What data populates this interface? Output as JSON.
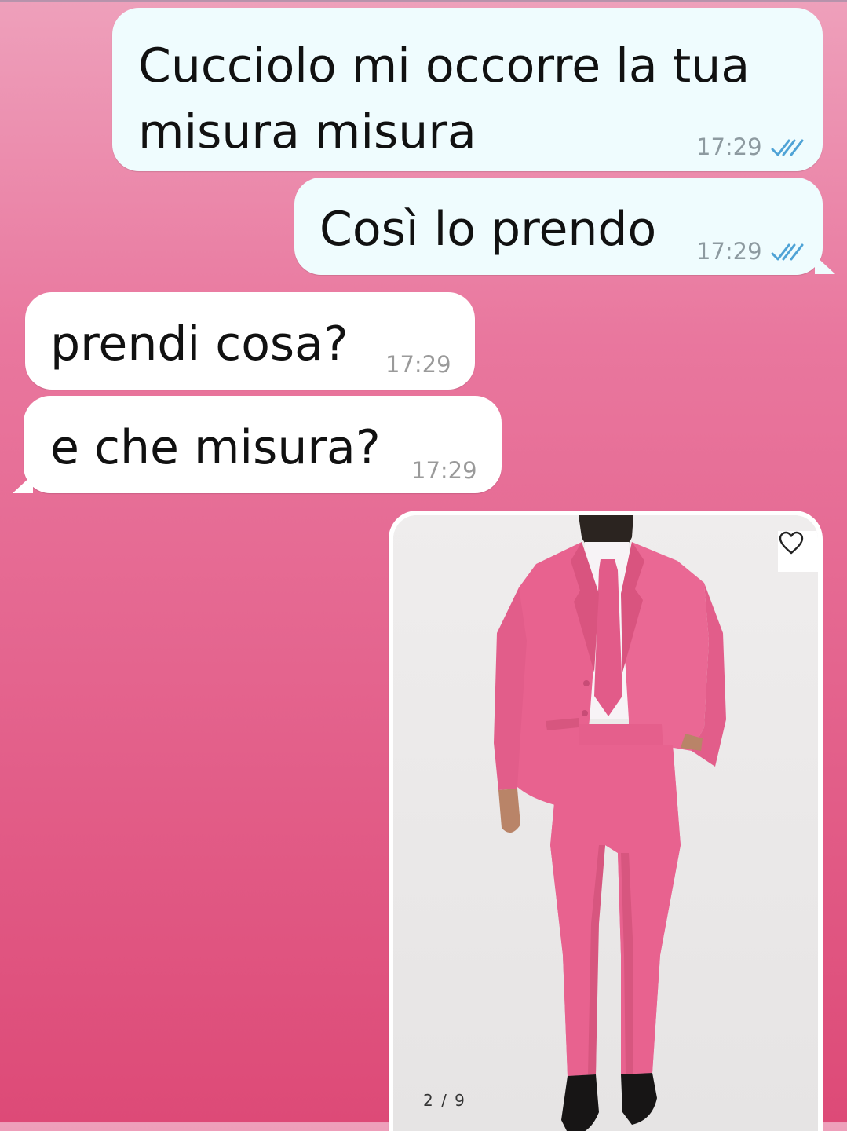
{
  "chat": {
    "messages": [
      {
        "direction": "out",
        "text": "Cucciolo mi occorre la tua\nmisura misura",
        "time": "17:29",
        "status": "read"
      },
      {
        "direction": "out",
        "text": "Così lo prendo",
        "time": "17:29",
        "status": "read"
      },
      {
        "direction": "in",
        "text": "prendi cosa?",
        "time": "17:29"
      },
      {
        "direction": "in",
        "text": "e che misura?",
        "time": "17:29"
      }
    ],
    "image_message": {
      "direction": "out",
      "content": "pink-suit-product-photo",
      "counter": "2 / 9",
      "favorite_icon": "heart-outline-icon"
    }
  },
  "colors": {
    "background_top": "#eea0bb",
    "background_bottom": "#dd4a77",
    "outgoing_bubble": "#effcfe",
    "incoming_bubble": "#ffffff",
    "read_tick": "#4fa3d6",
    "suit": "#e8628f"
  }
}
